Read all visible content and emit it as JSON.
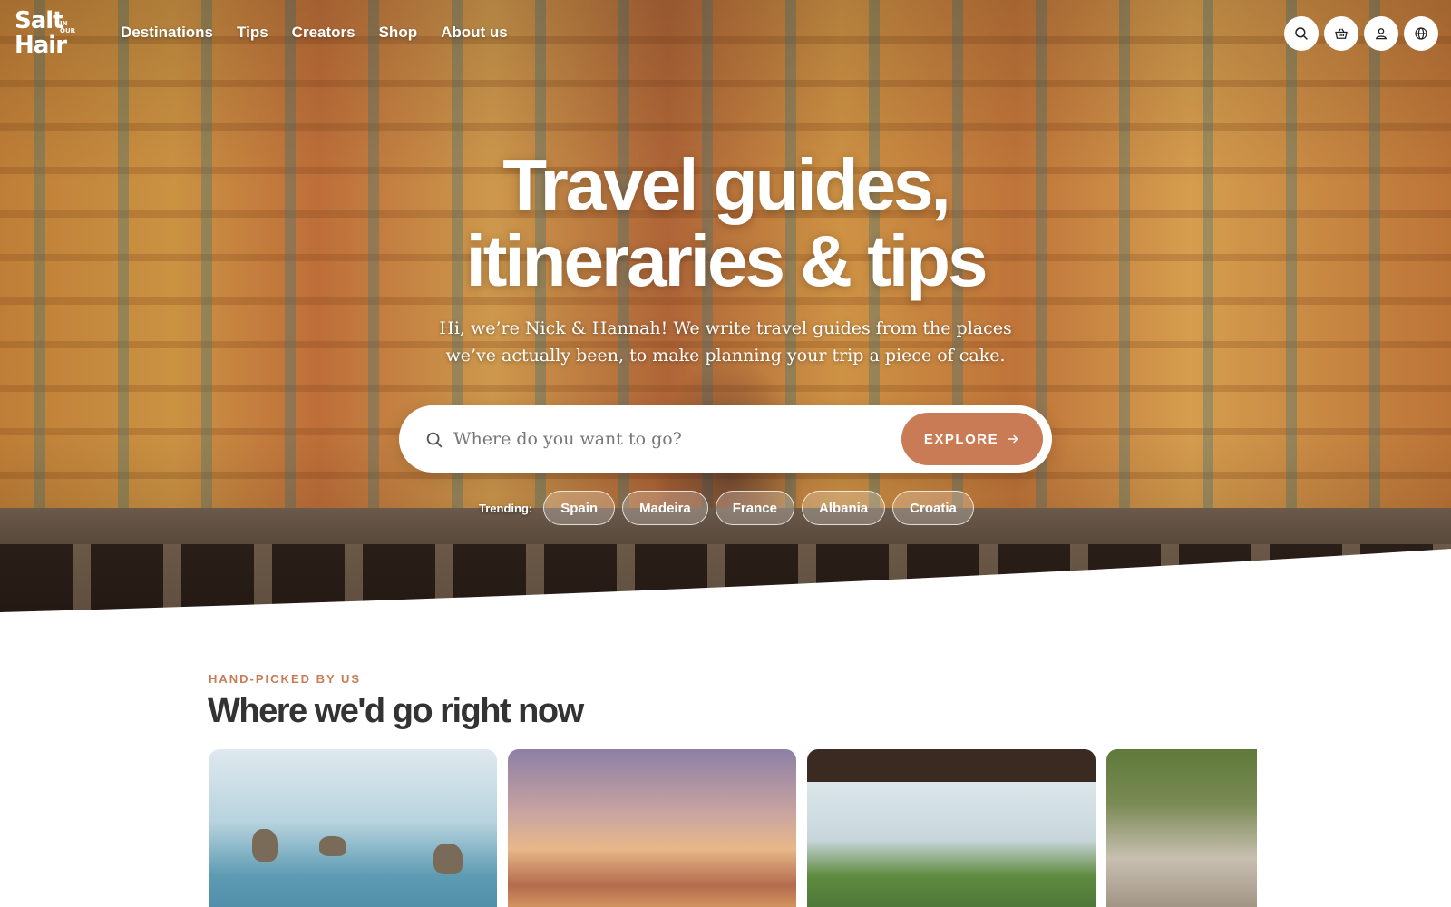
{
  "brand": {
    "logo_line1": "Salt",
    "logo_small": "IN OUR",
    "logo_line2": "Hair"
  },
  "nav": {
    "items": [
      "Destinations",
      "Tips",
      "Creators",
      "Shop",
      "About us"
    ],
    "icons": [
      "search-icon",
      "basket-icon",
      "user-icon",
      "globe-icon"
    ]
  },
  "hero": {
    "headline_line1": "Travel guides,",
    "headline_line2": "itineraries & tips",
    "subtext_line1": "Hi, we’re Nick & Hannah! We write travel guides from the places",
    "subtext_line2": "we’ve actually been, to make planning your trip a piece of cake."
  },
  "search": {
    "placeholder": "Where do you want to go?",
    "button_label": "EXPLORE"
  },
  "trending": {
    "label": "Trending:",
    "items": [
      "Spain",
      "Madeira",
      "France",
      "Albania",
      "Croatia"
    ]
  },
  "section": {
    "eyebrow": "HAND-PICKED BY US",
    "title": "Where we'd go right now"
  },
  "colors": {
    "accent": "#c97b55",
    "heading": "#333333",
    "white": "#ffffff"
  }
}
